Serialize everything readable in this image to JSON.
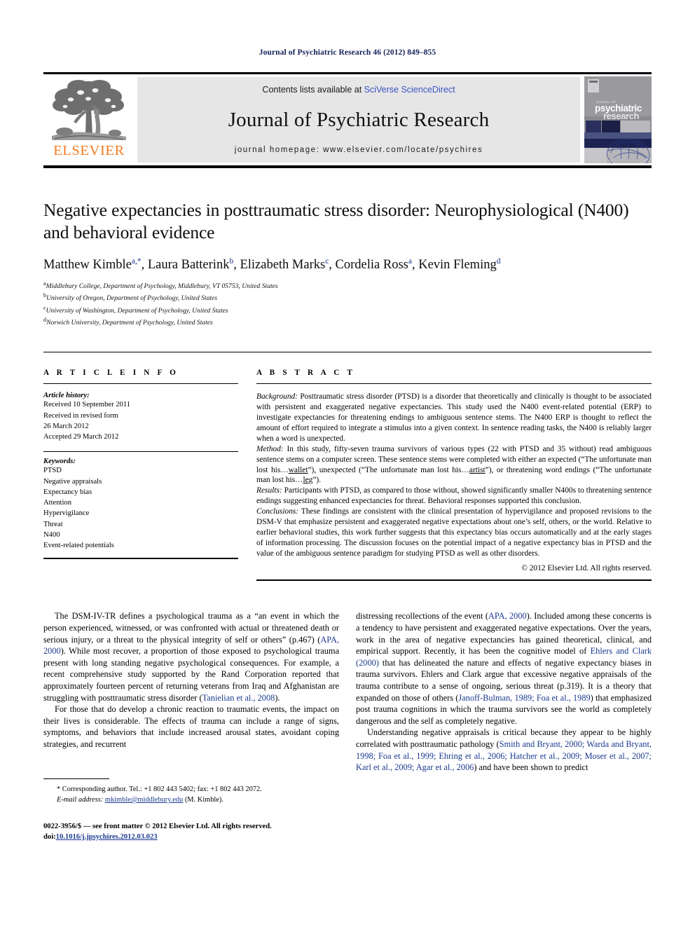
{
  "running_head": "Journal of Psychiatric Research 46 (2012) 849–855",
  "masthead": {
    "publisher_name": "ELSEVIER",
    "contents_prefix": "Contents lists available at ",
    "sciencedirect_link": "SciVerse ScienceDirect",
    "journal_title": "Journal of Psychiatric Research",
    "homepage_line": "journal homepage: www.elsevier.com/locate/psychires",
    "cover": {
      "journal_of": "JOURNAL OF",
      "line1": "psychiatric",
      "line2": "research"
    }
  },
  "article": {
    "title": "Negative expectancies in posttraumatic stress disorder: Neurophysiological (N400) and behavioral evidence",
    "authors": [
      {
        "name": "Matthew Kimble",
        "marks": "a,*"
      },
      {
        "name": "Laura Batterink",
        "marks": "b"
      },
      {
        "name": "Elizabeth Marks",
        "marks": "c"
      },
      {
        "name": "Cordelia Ross",
        "marks": "a"
      },
      {
        "name": "Kevin Fleming",
        "marks": "d"
      }
    ],
    "affiliations": [
      {
        "mark": "a",
        "text": "Middlebury College, Department of Psychology, Middlebury, VT 05753, United States"
      },
      {
        "mark": "b",
        "text": "University of Oregon, Department of Psychology, United States"
      },
      {
        "mark": "c",
        "text": "University of Washington, Department of Psychology, United States"
      },
      {
        "mark": "d",
        "text": "Norwich University, Department of Psychology, United States"
      }
    ]
  },
  "article_info": {
    "heading": "A R T I C L E   I N F O",
    "history_label": "Article history:",
    "history_lines": [
      "Received 10 September 2011",
      "Received in revised form",
      "26 March 2012",
      "Accepted 29 March 2012"
    ],
    "keywords_label": "Keywords:",
    "keywords": [
      "PTSD",
      "Negative appraisals",
      "Expectancy bias",
      "Attention",
      "Hypervigilance",
      "Threat",
      "N400",
      "Event-related potentials"
    ]
  },
  "abstract": {
    "heading": "A B S T R A C T",
    "background_label": "Background:",
    "background_text": " Posttraumatic stress disorder (PTSD) is a disorder that theoretically and clinically is thought to be associated with persistent and exaggerated negative expectancies. This study used the N400 event-related potential (ERP) to investigate expectancies for threatening endings to ambiguous sentence stems. The N400 ERP is thought to reflect the amount of effort required to integrate a stimulus into a given context. In sentence reading tasks, the N400 is reliably larger when a word is unexpected.",
    "method_label": "Method:",
    "method_text_1": " In this study, fifty-seven trauma survivors of various types (22 with PTSD and 35 without) read ambiguous sentence stems on a computer screen. These sentence stems were completed with either an expected (“The unfortunate man lost his…",
    "method_underline_1": "wallet",
    "method_text_2": "”), unexpected (“The unfortunate man lost his…",
    "method_underline_2": "artist",
    "method_text_3": "”), or threatening word endings (“The unfortunate man lost his…",
    "method_underline_3": "leg",
    "method_text_4": "”).",
    "results_label": "Results:",
    "results_text": " Participants with PTSD, as compared to those without, showed significantly smaller N400s to threatening sentence endings suggesting enhanced expectancies for threat. Behavioral responses supported this conclusion.",
    "conclusions_label": "Conclusions:",
    "conclusions_text": " These findings are consistent with the clinical presentation of hypervigilance and proposed revisions to the DSM-V that emphasize persistent and exaggerated negative expectations about one’s self, others, or the world. Relative to earlier behavioral studies, this work further suggests that this expectancy bias occurs automatically and at the early stages of information processing. The discussion focuses on the potential impact of a negative expectancy bias in PTSD and the value of the ambiguous sentence paradigm for studying PTSD as well as other disorders.",
    "copyright": "© 2012 Elsevier Ltd. All rights reserved."
  },
  "body": {
    "left": {
      "p1_a": "The DSM-IV-TR defines a psychological trauma as a “an event in which the person experienced, witnessed, or was confronted with actual or threatened death or serious injury, or a threat to the physical integrity of self or others” (p.467) (",
      "p1_ref1": "APA, 2000",
      "p1_b": "). While most recover, a proportion of those exposed to psychological trauma present with long standing negative psychological consequences. For example, a recent comprehensive study supported by the Rand Corporation reported that approximately fourteen percent of returning veterans from Iraq and Afghanistan are struggling with posttraumatic stress disorder (",
      "p1_ref2": "Tanielian et al., 2008",
      "p1_c": ").",
      "p2": "For those that do develop a chronic reaction to traumatic events, the impact on their lives is considerable. The effects of trauma can include a range of signs, symptoms, and behaviors that include increased arousal states, avoidant coping strategies, and recurrent"
    },
    "right": {
      "p1_a": "distressing recollections of the event (",
      "p1_ref1": "APA, 2000",
      "p1_b": "). Included among these concerns is a tendency to have persistent and exaggerated negative expectations. Over the years, work in the area of negative expectancies has gained theoretical, clinical, and empirical support. Recently, it has been the cognitive model of ",
      "p1_ref2": "Ehlers and Clark (2000)",
      "p1_c": " that has delineated the nature and effects of negative expectancy biases in trauma survivors. Ehlers and Clark argue that excessive negative appraisals of the trauma contribute to a sense of ongoing, serious threat (p.319). It is a theory that expanded on those of others (",
      "p1_ref3": "Janoff-Bulman, 1989; Foa et al., 1989",
      "p1_d": ") that emphasized post trauma cognitions in which the trauma survivors see the world as completely dangerous and the self as completely negative.",
      "p2_a": "Understanding negative appraisals is critical because they appear to be highly correlated with posttraumatic pathology (",
      "p2_ref1": "Smith and Bryant, 2000; Warda and Bryant, 1998; Foa et al., 1999; Ehring et al., 2006; Hatcher et al., 2009; Moser et al., 2007; Karl et al., 2009; Agar et al., 2006",
      "p2_b": ") and have been shown to predict"
    }
  },
  "footnotes": {
    "corresponding": "* Corresponding author. Tel.: +1 802 443 5402; fax: +1 802 443 2072.",
    "email_label": "E-mail address:",
    "email": "mkimble@middlebury.edu",
    "email_suffix": " (M. Kimble)."
  },
  "imprint": {
    "line1": "0022-3956/$ — see front matter © 2012 Elsevier Ltd. All rights reserved.",
    "doi_prefix": "doi:",
    "doi": "10.1016/j.jpsychires.2012.03.023"
  },
  "colors": {
    "running_head": "#14205a",
    "elsevier_orange": "#f47a20",
    "sciencedirect_blue": "#3a53c4",
    "reference_blue": "#1b3a8f",
    "masthead_grey": "#e6e6e6"
  }
}
